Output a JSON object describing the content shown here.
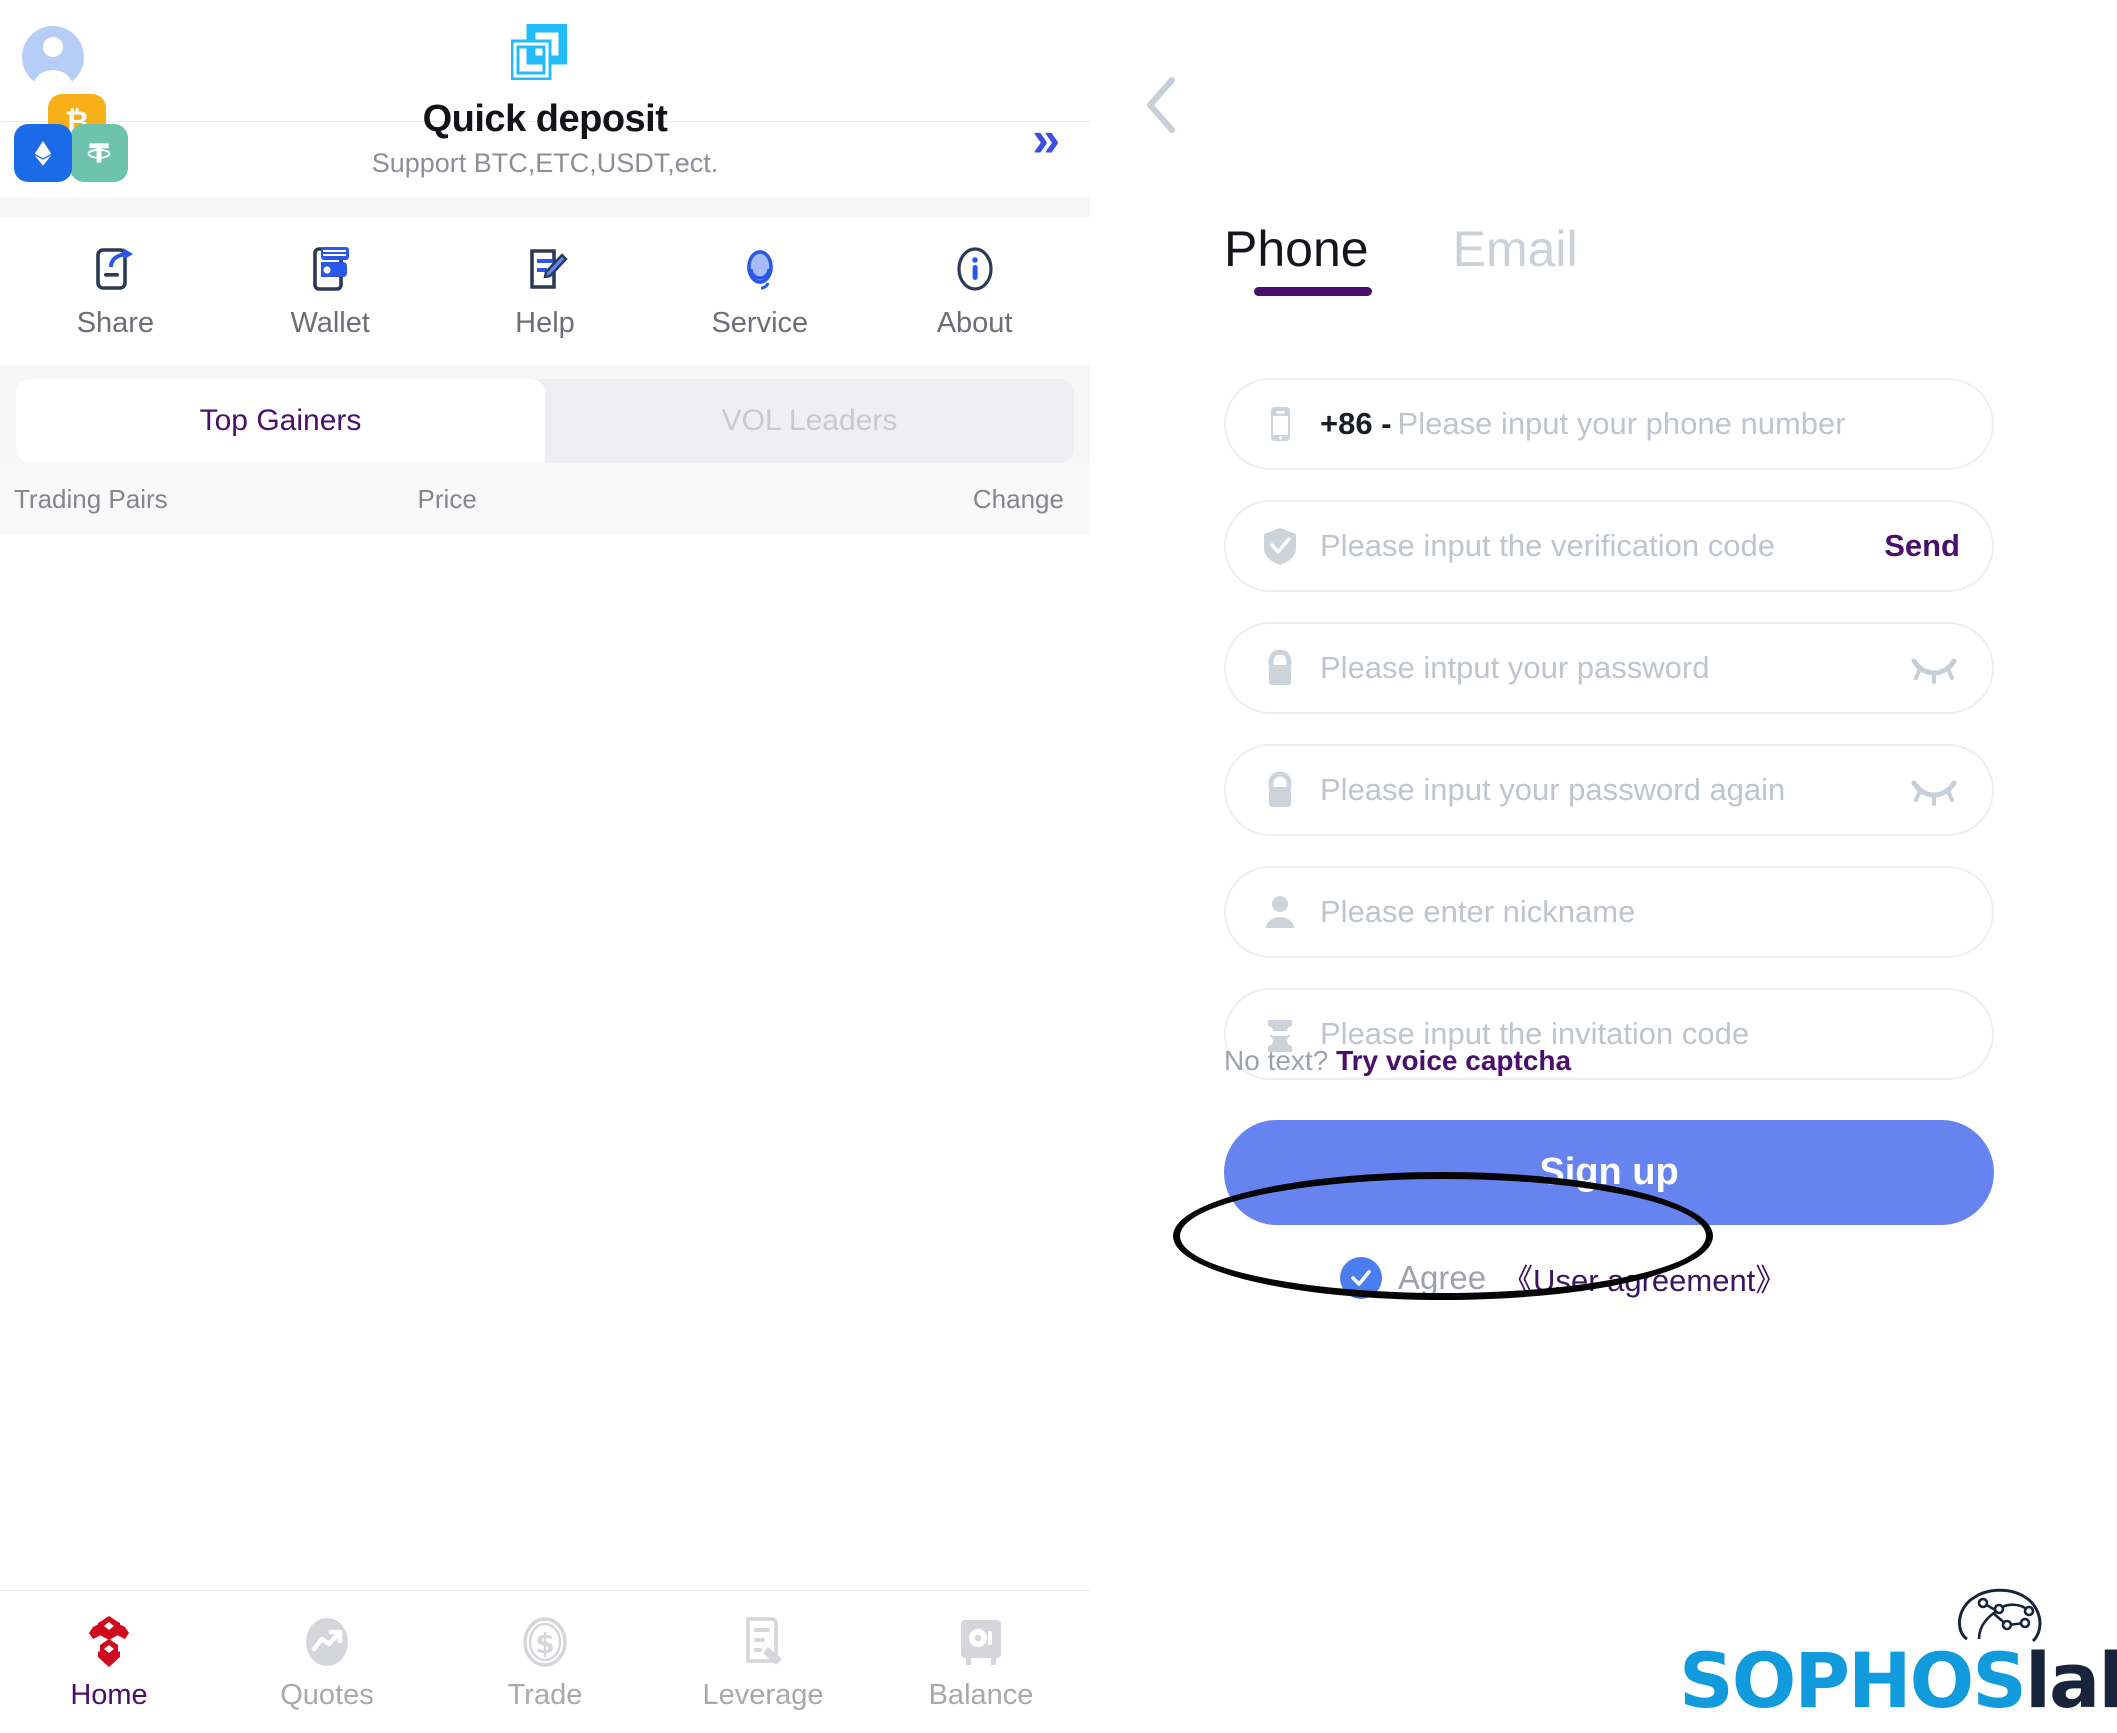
{
  "left": {
    "topbar": {
      "avatar": "avatar-icon",
      "logo": "app-logo"
    },
    "quick_deposit": {
      "title": "Quick deposit",
      "subtitle": "Support BTC,ETC,USDT,ect.",
      "arrow": "»",
      "coins": [
        "BTC",
        "ETH",
        "USDT"
      ]
    },
    "menu": [
      {
        "label": "Share",
        "icon": "share-icon"
      },
      {
        "label": "Wallet",
        "icon": "wallet-icon"
      },
      {
        "label": "Help",
        "icon": "help-icon"
      },
      {
        "label": "Service",
        "icon": "headset-icon"
      },
      {
        "label": "About",
        "icon": "info-icon"
      }
    ],
    "market_tabs": [
      {
        "label": "Top Gainers",
        "active": true
      },
      {
        "label": "VOL Leaders",
        "active": false
      }
    ],
    "table_headers": {
      "pairs": "Trading Pairs",
      "price": "Price",
      "change": "Change"
    },
    "table_rows": [],
    "bottom_nav": [
      {
        "label": "Home",
        "icon": "hexagon-logo-icon",
        "active": true
      },
      {
        "label": "Quotes",
        "icon": "trend-chart-icon",
        "active": false
      },
      {
        "label": "Trade",
        "icon": "dollar-coin-icon",
        "active": false
      },
      {
        "label": "Leverage",
        "icon": "document-coins-icon",
        "active": false
      },
      {
        "label": "Balance",
        "icon": "safe-vault-icon",
        "active": false
      }
    ]
  },
  "right": {
    "back_icon": "chevron-left-icon",
    "auth_tabs": [
      {
        "label": "Phone",
        "active": true
      },
      {
        "label": "Email",
        "active": false
      }
    ],
    "fields": {
      "phone": {
        "icon": "mobile-phone-icon",
        "prefix": "+86 -",
        "placeholder": "Please input your phone number"
      },
      "verification": {
        "icon": "shield-check-icon",
        "placeholder": "Please input the verification code",
        "action": "Send"
      },
      "password": {
        "icon": "lock-icon",
        "placeholder": "Please intput your password",
        "toggle": "eye-off-icon"
      },
      "password_again": {
        "icon": "lock-icon",
        "placeholder": "Please input your password again",
        "toggle": "eye-off-icon"
      },
      "nickname": {
        "icon": "person-icon",
        "placeholder": "Please enter nickname"
      },
      "invitation": {
        "icon": "ticket-icon",
        "placeholder": "Please input the invitation code"
      }
    },
    "voice": {
      "prefix": "No text?",
      "link": "Try voice captcha"
    },
    "signup_label": "Sign up",
    "agree": {
      "checked": true,
      "label": "Agree",
      "link": "《User agreement》"
    },
    "watermark": {
      "part1": "SOPHOS",
      "part2": "labs"
    }
  },
  "colors": {
    "accent_purple": "#4a0e6d",
    "signup_blue": "#6683f0",
    "logo_cyan": "#22bcfb",
    "home_red": "#cf0a1e",
    "sophos_blue": "#119bdd",
    "sophos_dark": "#18243b"
  }
}
